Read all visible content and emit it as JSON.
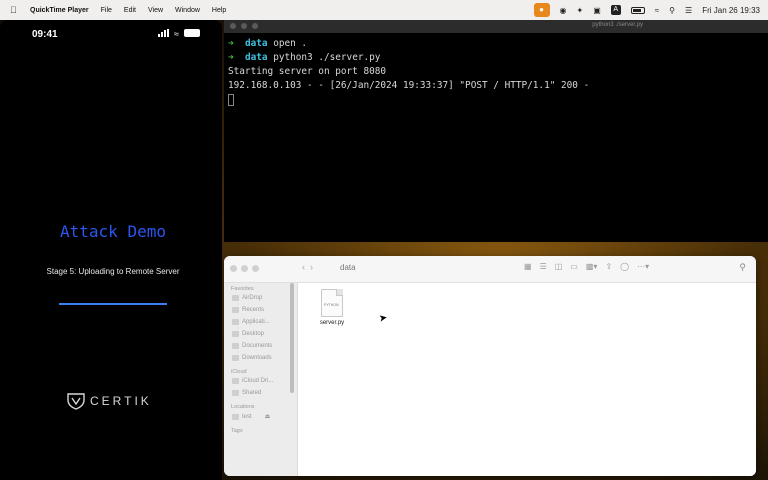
{
  "menubar": {
    "app_name": "QuickTime Player",
    "items": [
      "File",
      "Edit",
      "View",
      "Window",
      "Help"
    ],
    "input_letter": "A",
    "datetime": "Fri Jan 26  19:33"
  },
  "phone": {
    "time": "09:41",
    "title": "Attack Demo",
    "stage": "Stage 5: Uploading to Remote Server",
    "progress": 1.0,
    "brand": "CERTIK"
  },
  "terminal": {
    "title": "python3 ./server.py",
    "prompt_dir": "data",
    "cmd1": "open .",
    "cmd2": "python3 ./server.py",
    "out1": "Starting server on port 8080",
    "out2": "192.168.0.103 - - [26/Jan/2024 19:33:37] \"POST / HTTP/1.1\" 200 -"
  },
  "finder": {
    "title": "data",
    "sidebar": {
      "favorites_label": "Favorites",
      "favorites": [
        "AirDrop",
        "Recents",
        "Applicati...",
        "Desktop",
        "Documents",
        "Downloads"
      ],
      "icloud_label": "iCloud",
      "icloud": [
        "iCloud Dri...",
        "Shared"
      ],
      "locations_label": "Locations",
      "locations": [
        "test"
      ],
      "tags_label": "Tags"
    },
    "file": {
      "name": "server.py",
      "type": "PYTHON"
    }
  },
  "colors": {
    "accent_blue": "#2b56f0",
    "prompt_green": "#3ec43e",
    "dir_cyan": "#3ec0e0"
  }
}
